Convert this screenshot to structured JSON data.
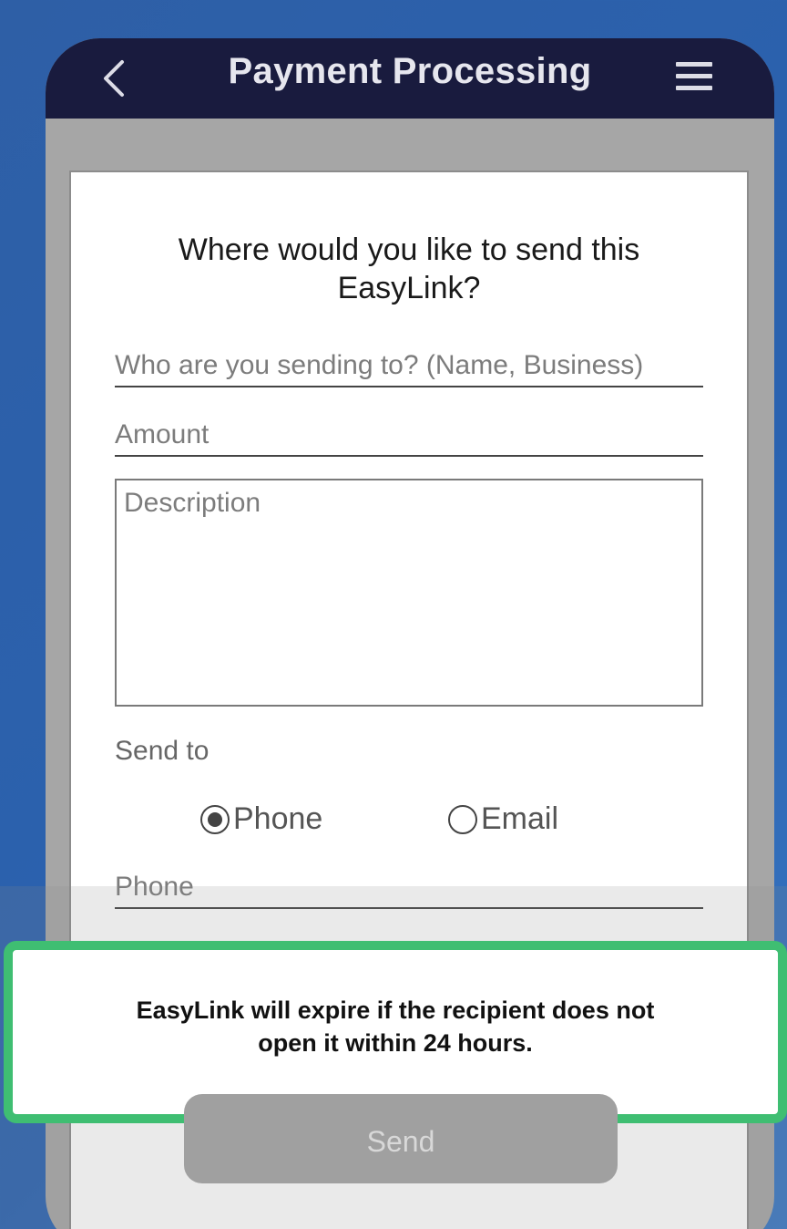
{
  "header": {
    "title": "Payment Processing",
    "back_icon": "chevron-left-icon",
    "menu_icon": "hamburger-menu-icon"
  },
  "form": {
    "prompt_line1": "Where would you like to send this",
    "prompt_line2": "EasyLink?",
    "recipient_placeholder": "Who are you sending to? (Name, Business)",
    "amount_placeholder": "Amount",
    "description_placeholder": "Description",
    "send_to_label": "Send to",
    "options": [
      {
        "label": "Phone",
        "selected": true
      },
      {
        "label": "Email",
        "selected": false
      }
    ],
    "phone_placeholder": "Phone"
  },
  "notice": {
    "line1": "EasyLink will expire if the recipient does not",
    "line2": "open it within 24 hours."
  },
  "send_label": "Send",
  "colors": {
    "header_bg": "#191b3e",
    "highlight_border": "#3fbe72",
    "background": "#2a62b0"
  }
}
